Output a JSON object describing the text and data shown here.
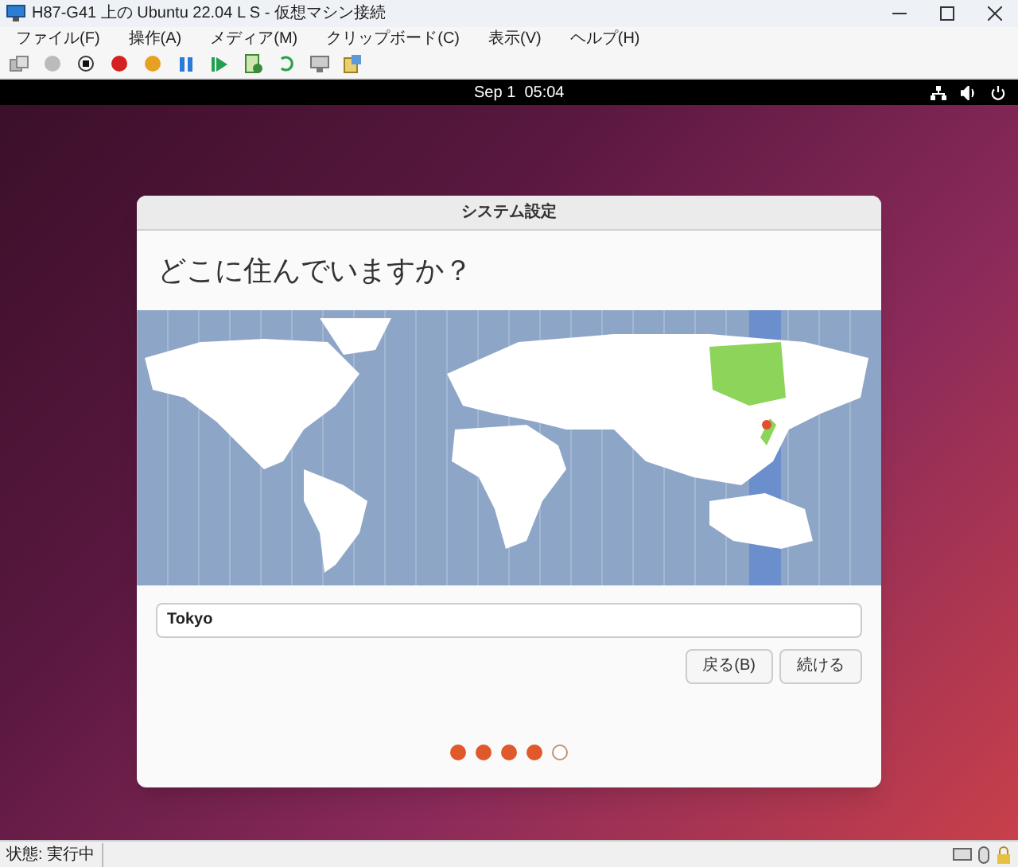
{
  "window": {
    "title": "H87-G41 上の Ubuntu 22.04 L S - 仮想マシン接続"
  },
  "menu": [
    "ファイル(F)",
    "操作(A)",
    "メディア(M)",
    "クリップボード(C)",
    "表示(V)",
    "ヘルプ(H)"
  ],
  "top_bar": {
    "clock": "Sep 1  05:04"
  },
  "dialog": {
    "title": "システム設定",
    "heading": "どこに住んでいますか？",
    "location": {
      "value": "Tokyo"
    },
    "buttons": [
      "戻る(B)",
      "続ける"
    ],
    "steps": [
      {
        "done": true
      },
      {
        "done": true
      },
      {
        "done": true
      },
      {
        "done": true
      },
      {
        "done": false
      }
    ]
  },
  "status_bar": {
    "text": "状態: 実行中"
  }
}
